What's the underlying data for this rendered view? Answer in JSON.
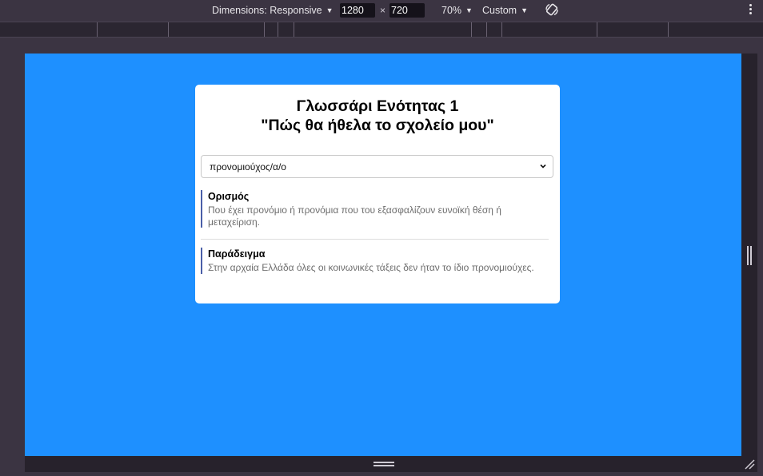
{
  "toolbar": {
    "dimensions_label": "Dimensions: Responsive",
    "width": "1280",
    "times": "×",
    "height": "720",
    "zoom": "70%",
    "throttle": "Custom"
  },
  "card": {
    "title_line1": "Γλωσσάρι Ενότητας 1",
    "title_line2": "\"Πώς θα ήθελα το σχολείο μου\"",
    "select_value": "προνομιούχος/α/ο",
    "definition": {
      "heading": "Ορισμός",
      "text": "Που έχει προνόμιο ή προνόμια που του εξασφαλίζουν ευνοϊκή θέση ή μεταχείριση."
    },
    "example": {
      "heading": "Παράδειγμα",
      "text": "Στην αρχαία Ελλάδα όλες οι κοινωνικές τάξεις δεν ήταν το ίδιο προνομιούχες."
    }
  },
  "colors": {
    "page_background": "#1e90ff",
    "accent_border": "#4a5fa8"
  }
}
